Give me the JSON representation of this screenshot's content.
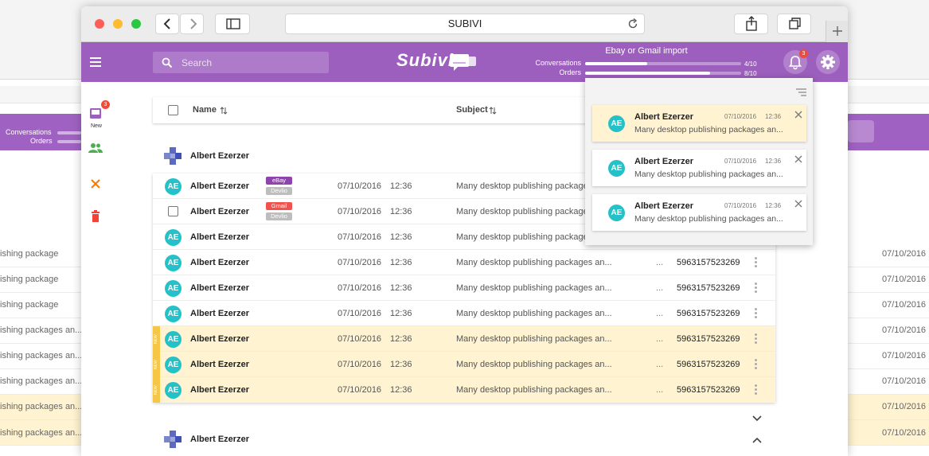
{
  "browser": {
    "url_title": "SUBIVI"
  },
  "app": {
    "brand": "Subivi",
    "search_placeholder": "Search",
    "import": {
      "title": "Ebay or Gmail import",
      "conversations_label": "Conversations",
      "conversations_value": "4/10",
      "conversations_progress": 0.4,
      "orders_label": "Orders",
      "orders_value": "8/10",
      "orders_progress": 0.8
    },
    "notifications_badge": "3"
  },
  "sidebar": {
    "inbox_badge": "3",
    "inbox_label": "New"
  },
  "list": {
    "headers": {
      "name": "Name",
      "subject": "Subject"
    },
    "group1_name": "Albert Ezerzer",
    "group2_name": "Albert Ezerzer",
    "rows": [
      {
        "initials": "AE",
        "name": "Albert Ezerzer",
        "tag1": "eBay",
        "tag2": "Devlio",
        "date": "07/10/2016",
        "time": "12:36",
        "subject": "Many desktop publishing package"
      },
      {
        "initials": "",
        "name": "Albert Ezerzer",
        "tag1": "Gmail",
        "tag2": "Devlio",
        "date": "07/10/2016",
        "time": "12:36",
        "subject": "Many desktop publishing package"
      },
      {
        "initials": "AE",
        "name": "Albert Ezerzer",
        "date": "07/10/2016",
        "time": "12:36",
        "subject": "Many desktop publishing package"
      },
      {
        "initials": "AE",
        "name": "Albert Ezerzer",
        "date": "07/10/2016",
        "time": "12:36",
        "subject": "Many desktop publishing packages an...",
        "dots": "...",
        "number": "5963157523269"
      },
      {
        "initials": "AE",
        "name": "Albert Ezerzer",
        "date": "07/10/2016",
        "time": "12:36",
        "subject": "Many desktop publishing packages an...",
        "dots": "...",
        "number": "5963157523269"
      },
      {
        "initials": "AE",
        "name": "Albert Ezerzer",
        "date": "07/10/2016",
        "time": "12:36",
        "subject": "Many desktop publishing packages an...",
        "dots": "...",
        "number": "5963157523269"
      },
      {
        "initials": "AE",
        "name": "Albert Ezerzer",
        "date": "07/10/2016",
        "time": "12:36",
        "subject": "Many desktop publishing packages an...",
        "dots": "...",
        "number": "5963157523269",
        "new_label": "NEW"
      },
      {
        "initials": "AE",
        "name": "Albert Ezerzer",
        "date": "07/10/2016",
        "time": "12:36",
        "subject": "Many desktop publishing packages an...",
        "dots": "...",
        "number": "5963157523269",
        "new_label": "NEW"
      },
      {
        "initials": "AE",
        "name": "Albert Ezerzer",
        "date": "07/10/2016",
        "time": "12:36",
        "subject": "Many desktop publishing packages an...",
        "dots": "...",
        "number": "5963157523269",
        "new_label": "NEW"
      }
    ]
  },
  "notifications": [
    {
      "initials": "AE",
      "name": "Albert Ezerzer",
      "date": "07/10/2016",
      "time": "12:36",
      "message": "Many desktop publishing packages an..."
    },
    {
      "initials": "AE",
      "name": "Albert Ezerzer",
      "date": "07/10/2016",
      "time": "12:36",
      "message": "Many desktop publishing packages an..."
    },
    {
      "initials": "AE",
      "name": "Albert Ezerzer",
      "date": "07/10/2016",
      "time": "12:36",
      "message": "Many desktop publishing packages an..."
    }
  ],
  "background": {
    "conversations_label": "Conversations",
    "orders_label": "Orders",
    "row_texts": [
      "ishing package",
      "ishing package",
      "ishing package",
      "ishing packages an...",
      "ishing packages an...",
      "ishing packages an...",
      "ishing packages an...",
      "ishing packages an..."
    ],
    "row_dates": [
      "07/10/2016",
      "07/10/2016",
      "07/10/2016",
      "07/10/2016",
      "07/10/2016",
      "07/10/2016",
      "07/10/2016",
      "07/10/2016"
    ]
  },
  "colors": {
    "brand_purple": "#9c5fbd",
    "avatar_teal": "#24c2c8",
    "unread_bg": "#fff3d1",
    "new_strip": "#f6c647",
    "ebay_tag": "#8e44ad",
    "gmail_tag": "#ef5350",
    "devlio_tag": "#bdbdbd",
    "badge_red": "#ef4b3b"
  }
}
